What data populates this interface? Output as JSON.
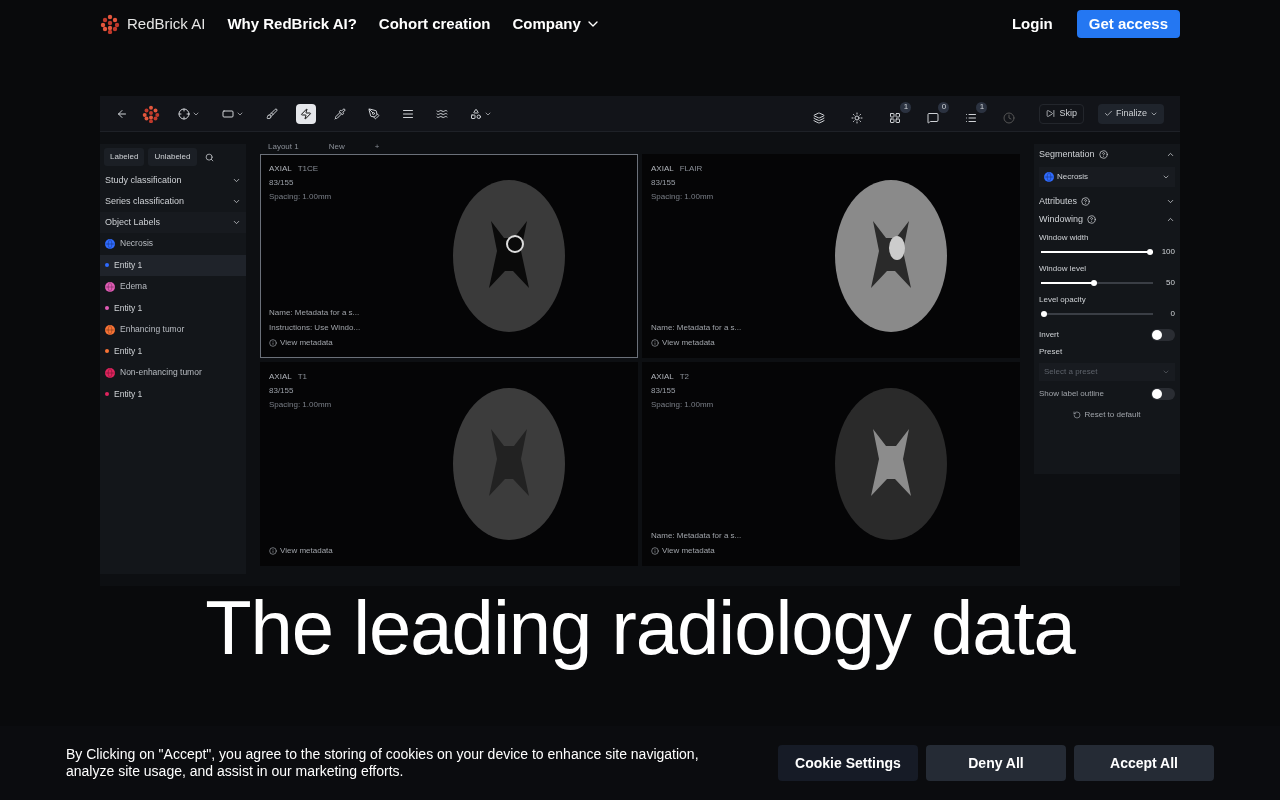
{
  "nav": {
    "brand": "RedBrick AI",
    "links": [
      {
        "label": "Why RedBrick AI?",
        "dropdown": false
      },
      {
        "label": "Cohort creation",
        "dropdown": false
      },
      {
        "label": "Company",
        "dropdown": true
      }
    ],
    "login": "Login",
    "cta": "Get access"
  },
  "app": {
    "toolbar": {
      "tools": [
        {
          "kind": "crosshair",
          "dropdown": true,
          "selected": false
        },
        {
          "kind": "rectangle",
          "dropdown": true,
          "selected": false
        },
        {
          "kind": "brush",
          "dropdown": false,
          "selected": false
        },
        {
          "kind": "lightning",
          "dropdown": false,
          "selected": true
        },
        {
          "kind": "dropper",
          "dropdown": false,
          "selected": false
        },
        {
          "kind": "pen",
          "dropdown": false,
          "selected": false
        },
        {
          "kind": "lines",
          "dropdown": false,
          "selected": false
        },
        {
          "kind": "waves",
          "dropdown": false,
          "selected": false
        },
        {
          "kind": "shapes",
          "dropdown": true,
          "selected": false
        }
      ],
      "actions": [
        {
          "kind": "layers"
        },
        {
          "kind": "sun"
        },
        {
          "kind": "grid",
          "badge": "1"
        },
        {
          "kind": "comment",
          "badge": "0"
        },
        {
          "kind": "list",
          "badge": "1"
        },
        {
          "kind": "clock"
        }
      ],
      "skip": "Skip",
      "finalize": "Finalize"
    },
    "left_panel": {
      "tabs": [
        "Labeled",
        "Unlabeled"
      ],
      "sections": [
        "Study classification",
        "Series classification",
        "Object Labels"
      ],
      "labels": [
        {
          "kind": "label",
          "name": "Necrosis",
          "color": "#2f6bff",
          "selected": false
        },
        {
          "kind": "entity",
          "name": "Entity 1",
          "color": "#2f6bff",
          "selected": true
        },
        {
          "kind": "label",
          "name": "Edema",
          "color": "#e05bb5",
          "selected": false
        },
        {
          "kind": "entity",
          "name": "Entity 1",
          "color": "#e05bb5",
          "selected": false
        },
        {
          "kind": "label",
          "name": "Enhancing tumor",
          "color": "#f97335",
          "selected": false
        },
        {
          "kind": "entity",
          "name": "Entity 1",
          "color": "#f97335",
          "selected": false
        },
        {
          "kind": "label",
          "name": "Non-enhancing tumor",
          "color": "#e0245e",
          "selected": false
        },
        {
          "kind": "entity",
          "name": "Entity 1",
          "color": "#e0245e",
          "selected": false
        }
      ]
    },
    "layout_tabs": [
      "Layout 1",
      "New",
      "+"
    ],
    "viewports": [
      {
        "plane": "AXIAL",
        "series": "T1CE",
        "slice": "83/155",
        "spacing": "Spacing: 1.00mm",
        "metadata": [
          "Name: Metadata for a s...",
          "Instructions: Use Windo..."
        ],
        "view": "View metadata",
        "selected": true
      },
      {
        "plane": "AXIAL",
        "series": "FLAIR",
        "slice": "83/155",
        "spacing": "Spacing: 1.00mm",
        "metadata": [
          "Name: Metadata for a s..."
        ],
        "view": "View metadata",
        "selected": false
      },
      {
        "plane": "AXIAL",
        "series": "T1",
        "slice": "83/155",
        "spacing": "Spacing: 1.00mm",
        "view": "View metadata",
        "selected": false
      },
      {
        "plane": "AXIAL",
        "series": "T2",
        "slice": "83/155",
        "spacing": "Spacing: 1.00mm",
        "metadata": [
          "Name: Metadata for a s..."
        ],
        "view": "View metadata",
        "selected": false
      }
    ],
    "right_panel": {
      "segmentation": "Segmentation",
      "selected_label": {
        "name": "Necrosis",
        "color": "#2f6bff"
      },
      "attributes": "Attributes",
      "windowing": "Windowing",
      "sliders": [
        {
          "label": "Window width",
          "level": 1,
          "reading": "100"
        },
        {
          "label": "Window level",
          "level": 0.47,
          "reading": "50"
        },
        {
          "label": "Level opacity",
          "level": 0,
          "reading": "0"
        }
      ],
      "invert": {
        "label": "Invert",
        "on": false
      },
      "preset": {
        "label": "Preset",
        "placeholder": "Select a preset"
      },
      "outline": {
        "label": "Show label outline",
        "on": false
      },
      "reset": "Reset to default"
    }
  },
  "headline": [
    "The leading radiology data"
  ],
  "cookie": {
    "text": "By Clicking on \"Accept\", you agree to the storing of cookies on your device to enhance site navigation, analyze site usage, and assist in our marketing efforts.",
    "buttons": [
      {
        "label": "Cookie Settings",
        "kind": "secondary"
      },
      {
        "label": "Deny All",
        "kind": "muted"
      },
      {
        "label": "Accept All",
        "kind": "muted"
      }
    ]
  }
}
